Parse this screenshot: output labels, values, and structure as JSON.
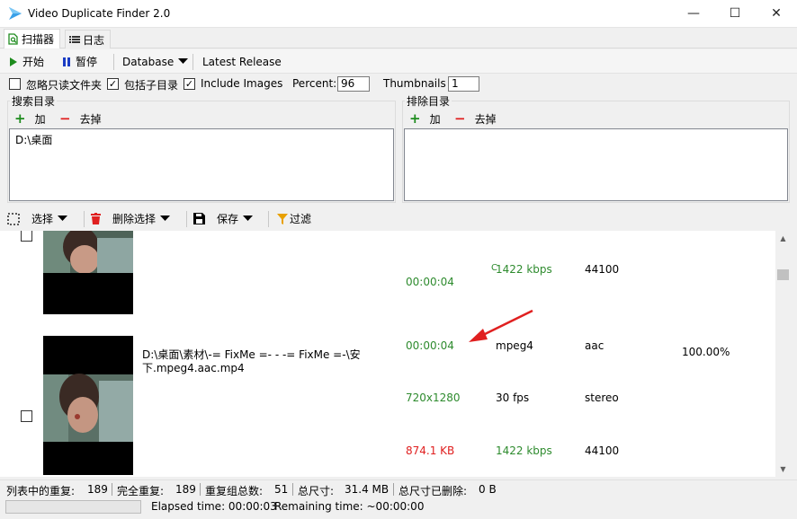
{
  "window": {
    "title": "Video Duplicate Finder 2.0",
    "minimize": "—",
    "maximize": "☐",
    "close": "✕"
  },
  "tabs": [
    {
      "label": "扫描器"
    },
    {
      "label": "日志"
    }
  ],
  "toolbar": {
    "start": "开始",
    "pause": "暂停",
    "database": "Database",
    "latest_release": "Latest Release"
  },
  "options": {
    "ignore_readonly": {
      "label": "忽略只读文件夹",
      "checked": false
    },
    "include_subdirs": {
      "label": "包括子目录",
      "checked": true
    },
    "include_images": {
      "label": "Include Images",
      "checked": true
    },
    "percent_label": "Percent:",
    "percent_value": "96",
    "thumbnails_label": "Thumbnails",
    "thumbnails_value": "1"
  },
  "search_dirs": {
    "title": "搜索目录",
    "add": "加",
    "remove": "去掉",
    "items": [
      "D:\\桌面"
    ]
  },
  "exclude_dirs": {
    "title": "排除目录",
    "add": "加",
    "remove": "去掉",
    "items": []
  },
  "results_toolbar": {
    "select": "选择",
    "delete_selection": "删除选择",
    "save": "保存",
    "filter": "过滤"
  },
  "results": {
    "row1": {
      "duration_partial": "C",
      "bitrate": "1422 kbps",
      "audio_rate": "44100",
      "duration": "00:00:04"
    },
    "row2": {
      "path_line1": "D:\\桌面\\素材\\-= FixMe =- - -= FixMe =-\\安",
      "path_line2": "下.mpeg4.aac.mp4",
      "duration": "00:00:04",
      "video_codec": "mpeg4",
      "audio_codec": "aac",
      "similarity": "100.00%",
      "resolution": "720x1280",
      "fps": "30 fps",
      "channels": "stereo",
      "size": "874.1 KB",
      "bitrate": "1422 kbps",
      "audio_rate": "44100"
    }
  },
  "status": {
    "dupes_in_list_label": "列表中的重复:",
    "dupes_in_list": "189",
    "full_dupes_label": "完全重复:",
    "full_dupes": "189",
    "groups_label": "重复组总数:",
    "groups": "51",
    "total_size_label": "总尺寸:",
    "total_size": "31.4 MB",
    "deleted_size_label": "总尺寸已删除:",
    "deleted_size": "0 B",
    "elapsed": "Elapsed time: 00:00:03",
    "remaining": "Remaining time: ~00:00:00"
  },
  "colors": {
    "green": "#2e8b2e",
    "red": "#e02020",
    "play": "#1e8c1e",
    "pause": "#1a3cc4",
    "delete": "#e02020",
    "filter": "#e8a000",
    "arrow": "#e02020"
  }
}
